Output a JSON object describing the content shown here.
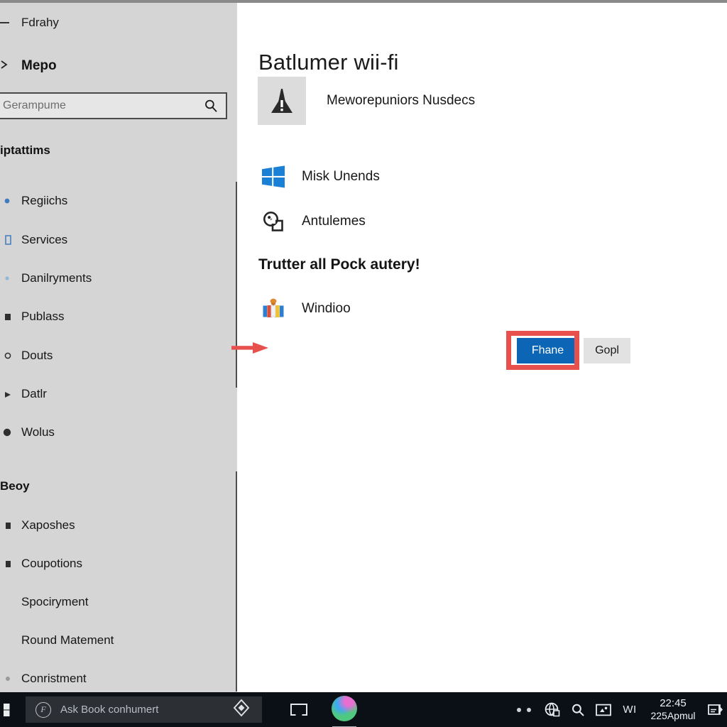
{
  "window": {
    "controls": {
      "minimize": "minimize-button",
      "maximize": "maximize-button",
      "close": "close-button"
    }
  },
  "sidebar": {
    "back_label": "Fdrahy",
    "title": "Mepo",
    "search": {
      "value": "",
      "placeholder": "Gerampume",
      "icon": "search-icon"
    },
    "groups": [
      {
        "header": "iptattims",
        "items": [
          {
            "label": "Regiichs",
            "icon": "bullet-icon"
          },
          {
            "label": "Services",
            "icon": "list-icon"
          },
          {
            "label": "Danilryments",
            "icon": "dot-icon"
          },
          {
            "label": "Publass",
            "icon": "square-icon"
          },
          {
            "label": "Douts",
            "icon": "gear-icon"
          },
          {
            "label": "Datlr",
            "icon": "triangle-icon"
          },
          {
            "label": "Wolus",
            "icon": "circle-icon"
          }
        ]
      },
      {
        "header": "Beoy",
        "items": [
          {
            "label": "Xaposhes",
            "icon": "square-icon"
          },
          {
            "label": "Coupotions",
            "icon": "square-icon"
          },
          {
            "label": "Spociryment",
            "icon": "none"
          },
          {
            "label": "Round Matement",
            "icon": "none"
          },
          {
            "label": "Conristment",
            "icon": "dot-icon"
          }
        ]
      }
    ]
  },
  "main": {
    "page_title": "Batlumer wii-fi",
    "status": {
      "icon": "warning-cone-icon",
      "text": "Meworepuniors Nusdecs"
    },
    "list_items": [
      {
        "label": "Misk Unends",
        "icon": "windows-logo-icon"
      },
      {
        "label": "Antulemes",
        "icon": "clock-history-icon"
      }
    ],
    "section_header": "Trutter all Pock autery!",
    "section_items": [
      {
        "label": "Windioo",
        "icon": "colorful-book-icon"
      }
    ],
    "buttons": {
      "primary": "Fhane",
      "secondary": "Gopl"
    },
    "annotation": {
      "arrow": "red-arrow-icon",
      "highlight_color": "#e8504d"
    }
  },
  "taskbar": {
    "start_icon": "windows-start-icon",
    "search": {
      "badge": "F",
      "placeholder": "Ask Book conhumert",
      "cortana_icon": "cortana-diamond-icon"
    },
    "task_view_icon": "task-view-icon",
    "app_icon": "cortana-orb-icon",
    "tray": {
      "overflow_icon": "overflow-dots-icon",
      "network_icon": "network-globe-icon",
      "search_icon": "search-icon",
      "display_icon": "display-icon",
      "language": "WI",
      "clock_time": "22:45",
      "clock_date": "225Apmul",
      "notification_icon": "action-center-icon"
    }
  },
  "colors": {
    "accent": "#0c66b5",
    "sidebar_bg": "#d5d5d5",
    "highlight": "#e8504d",
    "taskbar_bg": "#0b1017"
  }
}
